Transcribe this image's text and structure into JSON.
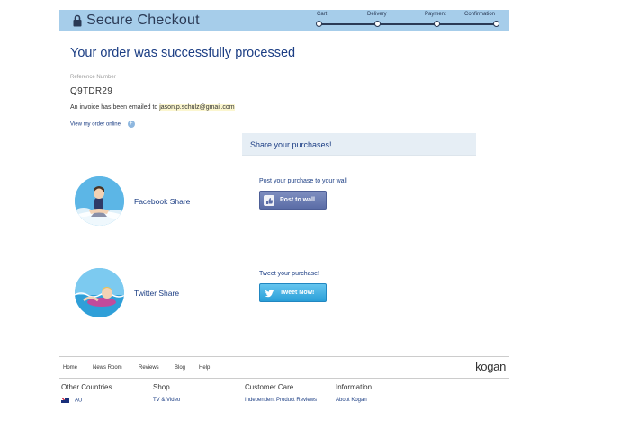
{
  "header": {
    "title": "Secure Checkout",
    "steps": [
      "Cart",
      "Delivery",
      "Payment",
      "Confirmation"
    ]
  },
  "main": {
    "success_title": "Your order was successfully processed",
    "reference_label": "Reference Number",
    "reference_value": "Q9TDR29",
    "invoice_text": "An invoice has been emailed to ",
    "invoice_email": "jason.p.schulz@gmail.com",
    "view_order": "View my order online."
  },
  "share": {
    "heading": "Share your purchases!",
    "facebook": {
      "name": "Facebook Share",
      "caption": "Post your purchase to your wall",
      "button": "Post to wall"
    },
    "twitter": {
      "name": "Twitter Share",
      "caption": "Tweet your purchase!",
      "button": "Tweet Now!"
    }
  },
  "footer": {
    "nav": [
      "Home",
      "News Room",
      "Reviews",
      "Blog",
      "Help"
    ],
    "logo": "kogan",
    "columns": [
      {
        "title": "Other Countries",
        "link": "AU"
      },
      {
        "title": "Shop",
        "link": "TV & Video"
      },
      {
        "title": "Customer Care",
        "link": "Independent Product Reviews"
      },
      {
        "title": "Information",
        "link": "About Kogan"
      }
    ]
  },
  "colors": {
    "header_bg": "#a6cdea",
    "accent": "#1c3e84",
    "facebook_button": "#5a6ca6",
    "twitter_button": "#2a9fd8"
  }
}
